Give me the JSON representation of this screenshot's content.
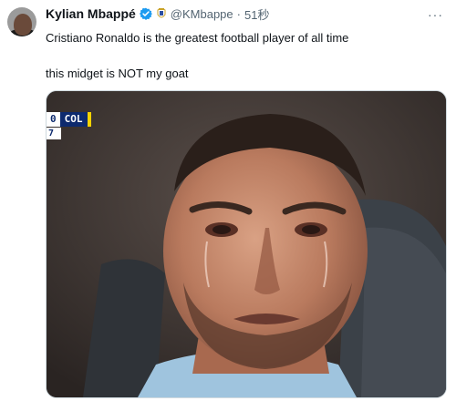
{
  "author": {
    "name": "Kylian Mbappé",
    "handle": "@KMbappe",
    "separator": "·",
    "time": "51秒"
  },
  "menu": {
    "more_label": "···"
  },
  "tweet": {
    "line1": "Cristiano Ronaldo is the greatest football player of all time",
    "line2": "this midget is NOT my goat"
  },
  "media": {
    "scorebug": {
      "score": "0",
      "team": "COL",
      "sub": "7"
    }
  },
  "colors": {
    "text": "#0f1419",
    "secondary": "#536471",
    "verified": "#1d9bf0",
    "scorebug_navy": "#0d2a6e",
    "scorebug_yellow": "#f5d300"
  }
}
